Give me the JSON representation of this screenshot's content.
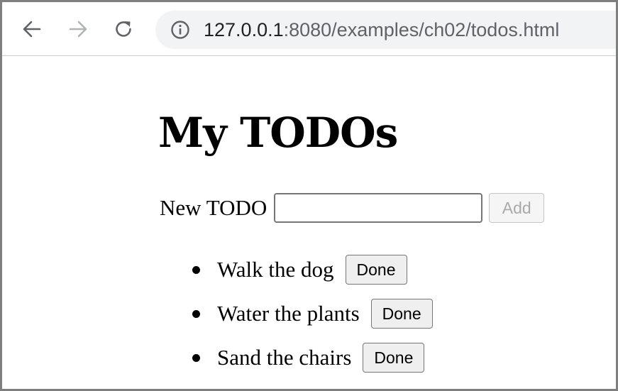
{
  "browser": {
    "url_host": "127.0.0.1",
    "url_rest": ":8080/examples/ch02/todos.html",
    "icons": {
      "back": "arrow-left-icon",
      "forward": "arrow-right-icon",
      "reload": "reload-icon",
      "info": "info-icon"
    }
  },
  "page": {
    "title": "My TODOs",
    "new_label": "New TODO",
    "input_value": "",
    "add_label": "Add",
    "todos": [
      {
        "text": "Walk the dog",
        "button": "Done"
      },
      {
        "text": "Water the plants",
        "button": "Done"
      },
      {
        "text": "Sand the chairs",
        "button": "Done"
      }
    ]
  },
  "colors": {
    "omnibox_bg": "#f1f3f4",
    "disabled_text": "#a9a9a9",
    "button_bg": "#efefef"
  }
}
